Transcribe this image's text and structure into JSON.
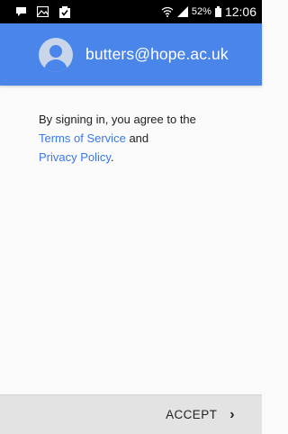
{
  "status_bar": {
    "battery_percent": "52%",
    "time": "12:06"
  },
  "account": {
    "email": "butters@hope.ac.uk",
    "avatar_icon": "person-icon"
  },
  "terms": {
    "intro": "By signing in, you agree to the",
    "terms_link": "Terms of Service",
    "and": "and",
    "privacy_link": "Privacy Policy",
    "end": "."
  },
  "footer": {
    "accept_label": "ACCEPT",
    "chevron": "›"
  },
  "colors": {
    "header": "#4a85ea",
    "link": "#3b78e7"
  }
}
